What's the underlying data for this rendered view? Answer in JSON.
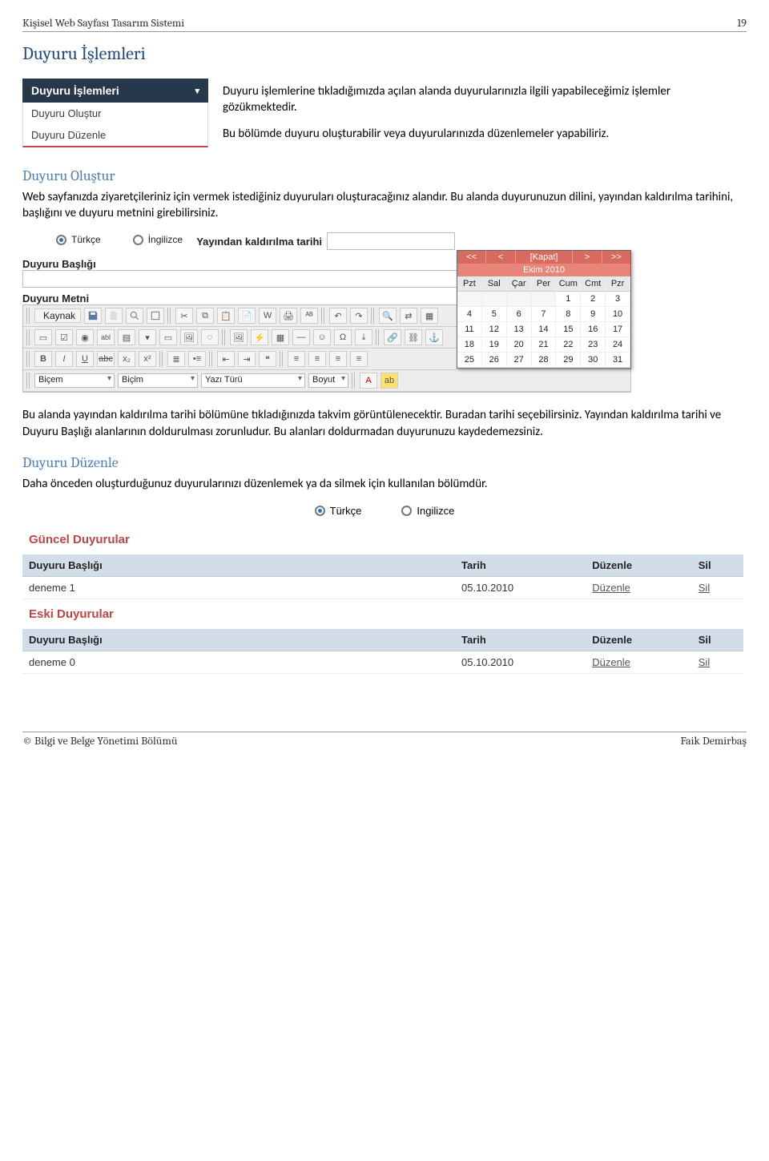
{
  "header": {
    "left": "Kişisel Web Sayfası Tasarım Sistemi",
    "right": "19"
  },
  "h_duyuru_islemleri": "Duyuru İşlemleri",
  "menu": {
    "title": "Duyuru İşlemleri",
    "item1": "Duyuru Oluştur",
    "item2": "Duyuru Düzenle"
  },
  "intro": {
    "p1": "Duyuru işlemlerine tıkladığımızda açılan alanda duyurularınızla ilgili yapabileceğimiz işlemler gözükmektedir.",
    "p2": "Bu bölümde duyuru oluşturabilir veya duyurularınızda düzenlemeler yapabiliriz."
  },
  "h_duyuru_olustur": "Duyuru Oluştur",
  "olustur_text": "Web sayfanızda ziyaretçileriniz için vermek istediğiniz duyuruları oluşturacağınız alandır. Bu alanda duyurunuzun dilini, yayından kaldırılma tarihini, başlığını ve duyuru metnini girebilirsiniz.",
  "form": {
    "lang_tr": "Türkçe",
    "lang_en": "İngilizce",
    "yk_label": "Yayından kaldırılma tarihi",
    "baslik_label": "Duyuru Başlığı",
    "metin_label": "Duyuru Metni",
    "kaynak": "Kaynak",
    "bicem": "Biçem",
    "bicim": "Biçim",
    "yazi_turu": "Yazı Türü",
    "boyut": "Boyut"
  },
  "calendar": {
    "nav": [
      "<<",
      "<",
      "[Kapat]",
      ">",
      ">>"
    ],
    "month": "Ekim 2010",
    "days": [
      "Pzt",
      "Sal",
      "Çar",
      "Per",
      "Cum",
      "Cmt",
      "Pzr"
    ],
    "rows": [
      [
        "",
        "",
        "",
        "",
        "1",
        "2",
        "3"
      ],
      [
        "4",
        "5",
        "6",
        "7",
        "8",
        "9",
        "10"
      ],
      [
        "11",
        "12",
        "13",
        "14",
        "15",
        "16",
        "17"
      ],
      [
        "18",
        "19",
        "20",
        "21",
        "22",
        "23",
        "24"
      ],
      [
        "25",
        "26",
        "27",
        "28",
        "29",
        "30",
        "31"
      ]
    ]
  },
  "after_form_text": "Bu alanda yayından kaldırılma tarihi bölümüne tıkladığınızda takvim görüntülenecektir. Buradan tarihi seçebilirsiniz. Yayından kaldırılma tarihi ve Duyuru Başlığı alanlarının doldurulması zorunludur. Bu alanları doldurmadan duyurunuzu kaydedemezsiniz.",
  "h_duyuru_duzenle": "Duyuru Düzenle",
  "duzenle_text": "Daha önceden oluşturduğunuz duyurularınızı düzenlemek ya da silmek için kullanılan bölümdür.",
  "lang_center": {
    "tr": "Türkçe",
    "en": "Ingilizce"
  },
  "tables": {
    "guncel_title": "Güncel Duyurular",
    "eski_title": "Eski Duyurular",
    "cols": {
      "baslik": "Duyuru Başlığı",
      "tarih": "Tarih",
      "duzenle": "Düzenle",
      "sil": "Sil"
    },
    "guncel_row": {
      "baslik": "deneme 1",
      "tarih": "05.10.2010",
      "duzenle": "Düzenle",
      "sil": "Sil"
    },
    "eski_row": {
      "baslik": "deneme 0",
      "tarih": "05.10.2010",
      "duzenle": "Düzenle",
      "sil": "Sil"
    }
  },
  "footer": {
    "left": "© Bilgi ve Belge Yönetimi Bölümü",
    "right": "Faik Demirbaş"
  }
}
